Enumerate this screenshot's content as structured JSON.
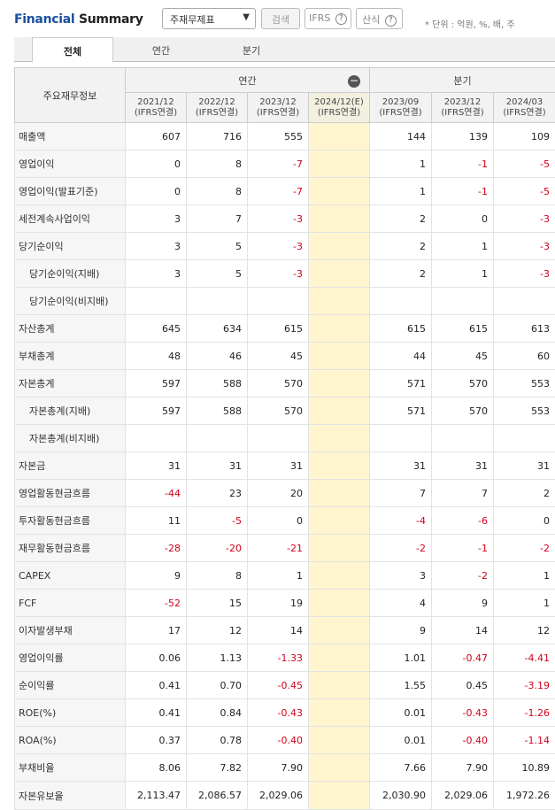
{
  "header": {
    "title_en": "Financial",
    "title_rest": " Summary",
    "select_value": "주재무제표",
    "search_label": "검색",
    "ifrs_label": "IFRS",
    "calc_label": "산식",
    "help_glyph": "?",
    "unit_text": "* 단위 : 억원, %, 배, 주"
  },
  "tabs": [
    "전체",
    "연간",
    "분기"
  ],
  "table": {
    "label_header": "주요재무정보",
    "annual_group": "연간",
    "quarter_group": "분기",
    "columns": [
      {
        "period": "2021/12",
        "basis": "(IFRS연결)"
      },
      {
        "period": "2022/12",
        "basis": "(IFRS연결)"
      },
      {
        "period": "2023/12",
        "basis": "(IFRS연결)"
      },
      {
        "period": "2024/12(E)",
        "basis": "(IFRS연결)"
      },
      {
        "period": "2023/09",
        "basis": "(IFRS연결)"
      },
      {
        "period": "2023/12",
        "basis": "(IFRS연결)"
      },
      {
        "period": "2024/03",
        "basis": "(IFRS연결)"
      }
    ],
    "rows": [
      {
        "label": "매출액",
        "indent": false,
        "values": [
          "607",
          "716",
          "555",
          "",
          "144",
          "139",
          "109"
        ]
      },
      {
        "label": "영업이익",
        "indent": false,
        "values": [
          "0",
          "8",
          "-7",
          "",
          "1",
          "-1",
          "-5"
        ]
      },
      {
        "label": "영업이익(발표기준)",
        "indent": false,
        "values": [
          "0",
          "8",
          "-7",
          "",
          "1",
          "-1",
          "-5"
        ]
      },
      {
        "label": "세전계속사업이익",
        "indent": false,
        "values": [
          "3",
          "7",
          "-3",
          "",
          "2",
          "0",
          "-3"
        ]
      },
      {
        "label": "당기순이익",
        "indent": false,
        "values": [
          "3",
          "5",
          "-3",
          "",
          "2",
          "1",
          "-3"
        ]
      },
      {
        "label": "당기순이익(지배)",
        "indent": true,
        "values": [
          "3",
          "5",
          "-3",
          "",
          "2",
          "1",
          "-3"
        ]
      },
      {
        "label": "당기순이익(비지배)",
        "indent": true,
        "values": [
          "",
          "",
          "",
          "",
          "",
          "",
          ""
        ]
      },
      {
        "label": "자산총계",
        "indent": false,
        "values": [
          "645",
          "634",
          "615",
          "",
          "615",
          "615",
          "613"
        ]
      },
      {
        "label": "부채총계",
        "indent": false,
        "values": [
          "48",
          "46",
          "45",
          "",
          "44",
          "45",
          "60"
        ]
      },
      {
        "label": "자본총계",
        "indent": false,
        "values": [
          "597",
          "588",
          "570",
          "",
          "571",
          "570",
          "553"
        ]
      },
      {
        "label": "자본총계(지배)",
        "indent": true,
        "values": [
          "597",
          "588",
          "570",
          "",
          "571",
          "570",
          "553"
        ]
      },
      {
        "label": "자본총계(비지배)",
        "indent": true,
        "values": [
          "",
          "",
          "",
          "",
          "",
          "",
          ""
        ]
      },
      {
        "label": "자본금",
        "indent": false,
        "values": [
          "31",
          "31",
          "31",
          "",
          "31",
          "31",
          "31"
        ]
      },
      {
        "label": "영업활동현금흐름",
        "indent": false,
        "values": [
          "-44",
          "23",
          "20",
          "",
          "7",
          "7",
          "2"
        ]
      },
      {
        "label": "투자활동현금흐름",
        "indent": false,
        "values": [
          "11",
          "-5",
          "0",
          "",
          "-4",
          "-6",
          "0"
        ]
      },
      {
        "label": "재무활동현금흐름",
        "indent": false,
        "values": [
          "-28",
          "-20",
          "-21",
          "",
          "-2",
          "-1",
          "-2"
        ]
      },
      {
        "label": "CAPEX",
        "indent": false,
        "values": [
          "9",
          "8",
          "1",
          "",
          "3",
          "-2",
          "1"
        ]
      },
      {
        "label": "FCF",
        "indent": false,
        "values": [
          "-52",
          "15",
          "19",
          "",
          "4",
          "9",
          "1"
        ]
      },
      {
        "label": "이자발생부채",
        "indent": false,
        "values": [
          "17",
          "12",
          "14",
          "",
          "9",
          "14",
          "12"
        ]
      },
      {
        "label": "영업이익률",
        "indent": false,
        "values": [
          "0.06",
          "1.13",
          "-1.33",
          "",
          "1.01",
          "-0.47",
          "-4.41"
        ]
      },
      {
        "label": "순이익률",
        "indent": false,
        "values": [
          "0.41",
          "0.70",
          "-0.45",
          "",
          "1.55",
          "0.45",
          "-3.19"
        ]
      },
      {
        "label": "ROE(%)",
        "indent": false,
        "values": [
          "0.41",
          "0.84",
          "-0.43",
          "",
          "0.01",
          "-0.43",
          "-1.26"
        ]
      },
      {
        "label": "ROA(%)",
        "indent": false,
        "values": [
          "0.37",
          "0.78",
          "-0.40",
          "",
          "0.01",
          "-0.40",
          "-1.14"
        ]
      },
      {
        "label": "부채비율",
        "indent": false,
        "values": [
          "8.06",
          "7.82",
          "7.90",
          "",
          "7.66",
          "7.90",
          "10.89"
        ]
      },
      {
        "label": "자본유보율",
        "indent": false,
        "values": [
          "2,113.47",
          "2,086.57",
          "2,029.06",
          "",
          "2,030.90",
          "2,029.06",
          "1,972.26"
        ]
      }
    ]
  },
  "colors": {
    "negative": "#d0021b",
    "estimate_bg": "#fff6cf",
    "title_blue": "#1a4fa0"
  },
  "icons": {
    "collapse": "minus-circle-icon",
    "help": "question-circle-icon",
    "dropdown": "chevron-down-icon"
  }
}
